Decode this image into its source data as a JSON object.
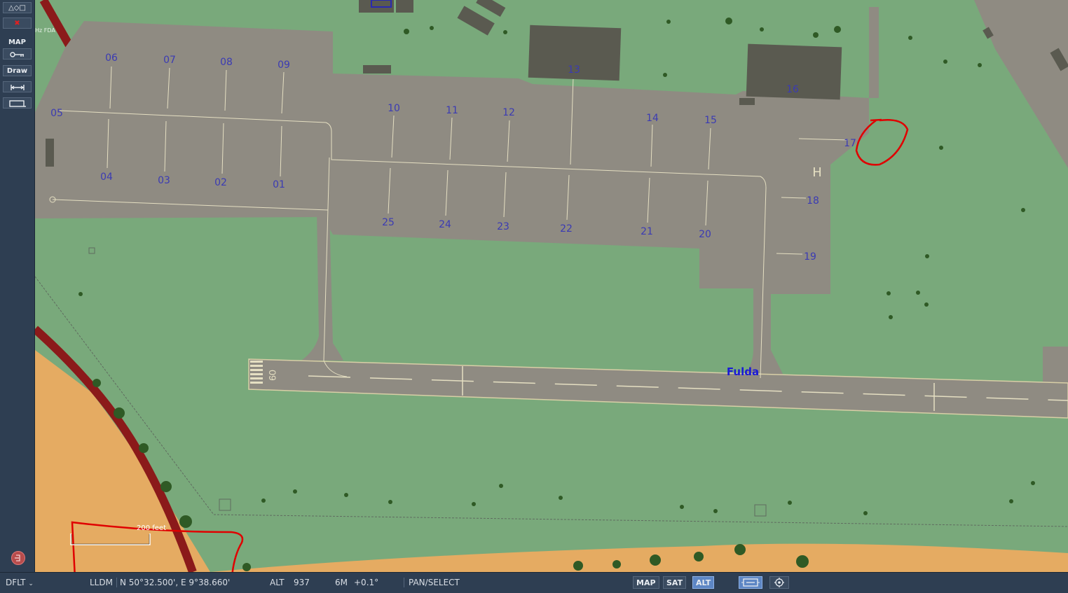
{
  "sidebar": {
    "shapes_label": "△◇□",
    "close_label": "✖",
    "map_label": "MAP",
    "draw_label": "Draw",
    "icons": [
      "key-icon",
      "measure-icon",
      "rectangle-icon",
      "logout-icon"
    ]
  },
  "map": {
    "airfield_name": "Fulda",
    "runway_number": "09",
    "corner_label": "Hz FDA",
    "scale_label": "200 feet",
    "parking_spots": [
      "01",
      "02",
      "03",
      "04",
      "05",
      "06",
      "07",
      "08",
      "09",
      "10",
      "11",
      "12",
      "13",
      "14",
      "15",
      "16",
      "17",
      "18",
      "19",
      "20",
      "21",
      "22",
      "23",
      "24",
      "25"
    ],
    "colors": {
      "grass": "#79a97b",
      "apron": "#8f8b82",
      "sand": "#e5ab62",
      "road": "#8b1a1a",
      "marker": "#3b3bb3",
      "annotation": "#e00000"
    }
  },
  "statusbar": {
    "profile": "DFLT",
    "coord_mode": "LLDM",
    "coordinates": "N 50°32.500', E  9°38.660'",
    "alt_label": "ALT",
    "alt_value": "937",
    "mag_label": "6M",
    "mag_value": "+0.1°",
    "mode": "PAN/SELECT",
    "toggle_map": "MAP",
    "toggle_sat": "SAT",
    "toggle_alt": "ALT",
    "active_toggle": "ALT"
  }
}
